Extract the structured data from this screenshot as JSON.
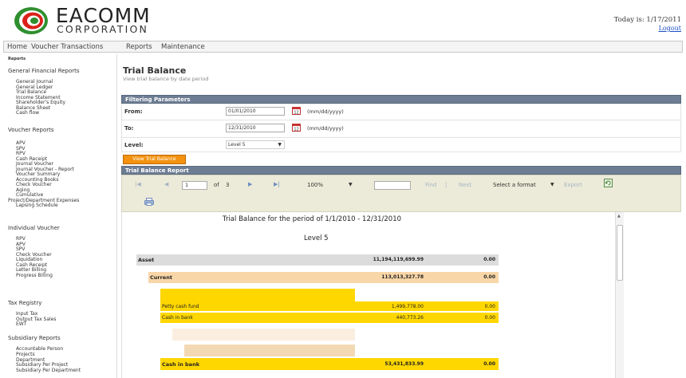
{
  "header": {
    "logo_word": "EACOMM",
    "logo_sub": "CORPORATION",
    "today": "Today is: 1/17/2011",
    "logout": "Logout"
  },
  "menu": [
    "Home",
    "Voucher Transactions",
    "Reports",
    "Maintenance"
  ],
  "sidebar": {
    "top_label": "Reports",
    "sections": [
      {
        "title": "General Financial Reports",
        "items": [
          "General Journal",
          "General Ledger",
          "Trial Balance",
          "Income Statement",
          "Shareholder's Equity",
          "Balance Sheet",
          "Cash flow"
        ]
      },
      {
        "title": "Voucher Reports",
        "items": [
          "APV",
          "SPV",
          "RPV",
          "Cash Receipt",
          "Journal Voucher",
          "Journal Voucher - Report",
          "Voucher Summary",
          "Accounting Books",
          "Check Voucher",
          "Aging",
          "Cumulative",
          "Project/Department Expenses",
          "Lapsing Schedule"
        ]
      },
      {
        "title": "Individual Voucher",
        "items": [
          "RPV",
          "APV",
          "SPV",
          "Check Voucher",
          "Liquidation",
          "Cash Receipt",
          "Letter Billing",
          "Progress Billing"
        ]
      },
      {
        "title": "Tax Registry",
        "items": [
          "Input Tax",
          "Output Tax Sales",
          "EWT"
        ]
      },
      {
        "title": "Subsidiary Reports",
        "items": [
          "Accountable Person",
          "Projects",
          "Department",
          "Subsidiary Per Project",
          "Subsidiary Per Department"
        ]
      }
    ]
  },
  "page": {
    "title": "Trial Balance",
    "subtitle": "View trial balance by date period"
  },
  "filters": {
    "header": "Filtering Parameters",
    "from_label": "From:",
    "from_value": "01/01/2010",
    "to_label": "To:",
    "to_value": "12/31/2010",
    "date_hint": "(mm/dd/yyyy)",
    "level_label": "Level:",
    "level_value": "Level 5",
    "view_button": "View Trial Balance"
  },
  "report": {
    "header": "Trial Balance Report",
    "toolbar": {
      "page": "1",
      "of": "of",
      "total_pages": "3",
      "zoom": "100%",
      "find": "Find",
      "separator": "|",
      "next": "Next",
      "format": "Select a format",
      "export": "Export"
    },
    "title": "Trial Balance for the period of 1/1/2010 - 12/31/2010",
    "level": "Level 5",
    "rows": [
      {
        "label": "Asset",
        "debit": "11,194,119,699.99",
        "credit": "0.00"
      },
      {
        "label": "Current",
        "debit": "113,013,327.78",
        "credit": "0.00"
      },
      {
        "label": "Petty cash fund",
        "debit": "1,499,778.00",
        "credit": "0.00"
      },
      {
        "label": "Cash in bank",
        "debit": "440,773.26",
        "credit": "0.00"
      },
      {
        "label": "Cash in bank",
        "debit": "53,431,833.99",
        "credit": "0.00"
      }
    ]
  },
  "colors": {
    "bar": "#6d7d93",
    "button": "#f2920f",
    "row_asset": "#dcdcdc",
    "row_current": "#f9d6a8",
    "row_detail": "#ffd700"
  }
}
